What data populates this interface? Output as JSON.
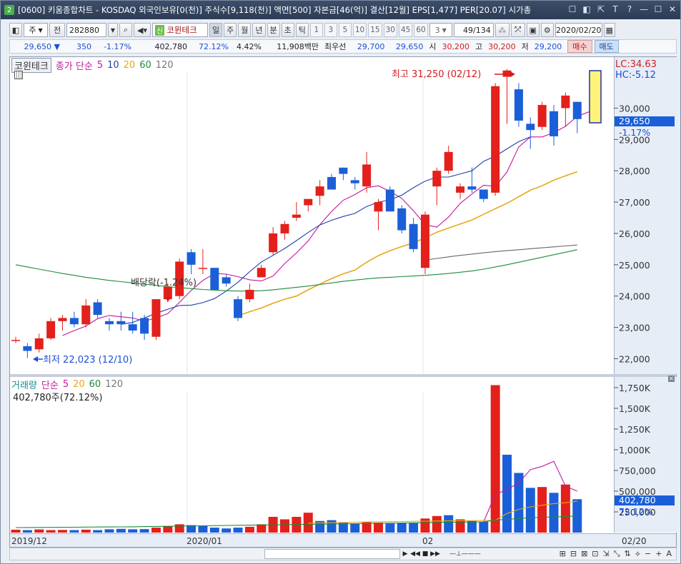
{
  "window": {
    "number": "2",
    "title": "[0600] 키움종합차트 - KOSDAQ 외국인보유[0(천)] 주식수[9,118(천)] 액면[500] 자본금[46(억)] 결산[12월] EPS[1,477] PER[20.07] 시가총",
    "controls": [
      "☐",
      "◧",
      "⇱",
      "T",
      "?",
      "—",
      "☐",
      "✕"
    ]
  },
  "toolbar": {
    "type_label": "주",
    "prev_label": "전",
    "code": "282880",
    "stock_name": "코윈테크",
    "shin_badge": "신",
    "period_buttons": [
      "일",
      "주",
      "월",
      "년",
      "분",
      "초",
      "틱"
    ],
    "minute_buttons": [
      "1",
      "3",
      "5",
      "10",
      "15",
      "30",
      "45",
      "60"
    ],
    "minute_custom": "3",
    "page_count": "49/134",
    "date": "2020/02/20"
  },
  "quote": {
    "price": "29,650 ▼",
    "change": "350",
    "change_pct": "-1.17%",
    "volume": "402,780",
    "volume_ratio": "72.12%",
    "turnover": "4.42%",
    "amount": "11,908백만",
    "best_label": "최우선",
    "ask": "29,700",
    "bid": "29,650",
    "open_label": "시",
    "open": "30,200",
    "high_label": "고",
    "high": "30,200",
    "low_label": "저",
    "low": "29,200",
    "buy_label": "매수",
    "sell_label": "매도"
  },
  "price_panel": {
    "stock_tag": "코윈테크",
    "legend_prefix": "종가 단순",
    "ma_periods": [
      "5",
      "10",
      "20",
      "60",
      "120"
    ],
    "ma_colors": [
      "#c2189b",
      "#1f3fa8",
      "#e6a817",
      "#1d8a3a",
      "#666666"
    ],
    "lc_label": "LC:34.63",
    "hc_label": "HC:-5.12",
    "current_price_label": "29,650",
    "current_change_label": "-1.17%",
    "high_annotation": "최고 31,250 (02/12)",
    "low_annotation": "최저 22,023 (12/10)",
    "dividend_annotation": "배당락(-1.24%)",
    "y_tick_labels": [
      "30,000",
      "29,000",
      "28,000",
      "27,000",
      "26,000",
      "25,000",
      "24,000",
      "23,000",
      "22,000"
    ]
  },
  "volume_panel": {
    "title": "거래량",
    "legend_prefix": "단순",
    "ma_periods": [
      "5",
      "20",
      "60",
      "120"
    ],
    "info": "402,780주(72.12%)",
    "current_label": "402,780",
    "current_pct_label": "72.12%",
    "y_tick_labels": [
      "1,750K",
      "1,500K",
      "1,250K",
      "1,000K",
      "750,000",
      "500,000",
      "250,000"
    ]
  },
  "date_axis": {
    "labels": [
      "2019/12",
      "2020/01",
      "02",
      "02/20"
    ]
  },
  "colors": {
    "up": "#e3201b",
    "down": "#1b5fd8",
    "ma5": "#c2189b",
    "ma10": "#1f3fa8",
    "ma20": "#e6a817",
    "ma60": "#1d8a3a",
    "ma120": "#666666"
  },
  "chart_data": [
    {
      "type": "candlestick",
      "title": "코윈테크",
      "ylim": [
        21600,
        31400
      ],
      "y_ticks": [
        22000,
        23000,
        24000,
        25000,
        26000,
        27000,
        28000,
        29000,
        30000
      ],
      "candles": [
        {
          "o": 22600,
          "h": 22700,
          "l": 22500,
          "c": 22600
        },
        {
          "o": 22400,
          "h": 22500,
          "l": 22020,
          "c": 22250
        },
        {
          "o": 22300,
          "h": 22800,
          "l": 22200,
          "c": 22650
        },
        {
          "o": 22650,
          "h": 23300,
          "l": 22600,
          "c": 23200
        },
        {
          "o": 23200,
          "h": 23400,
          "l": 22900,
          "c": 23300
        },
        {
          "o": 23300,
          "h": 23500,
          "l": 23000,
          "c": 23100
        },
        {
          "o": 23100,
          "h": 23900,
          "l": 23000,
          "c": 23700
        },
        {
          "o": 23800,
          "h": 23900,
          "l": 23300,
          "c": 23400
        },
        {
          "o": 23200,
          "h": 23300,
          "l": 22900,
          "c": 23100
        },
        {
          "o": 23200,
          "h": 23500,
          "l": 22900,
          "c": 23100
        },
        {
          "o": 23100,
          "h": 23500,
          "l": 22800,
          "c": 22900
        },
        {
          "o": 23300,
          "h": 23400,
          "l": 22600,
          "c": 22800
        },
        {
          "o": 22700,
          "h": 23900,
          "l": 22600,
          "c": 23900
        },
        {
          "o": 23900,
          "h": 24400,
          "l": 23800,
          "c": 24300
        },
        {
          "o": 24000,
          "h": 25200,
          "l": 23900,
          "c": 25100
        },
        {
          "o": 25400,
          "h": 25500,
          "l": 24700,
          "c": 25000
        },
        {
          "o": 24900,
          "h": 25500,
          "l": 24700,
          "c": 24900
        },
        {
          "o": 24900,
          "h": 24900,
          "l": 24200,
          "c": 24200
        },
        {
          "o": 24600,
          "h": 24700,
          "l": 24300,
          "c": 24400
        },
        {
          "o": 23900,
          "h": 24000,
          "l": 23200,
          "c": 23300
        },
        {
          "o": 23900,
          "h": 24400,
          "l": 23800,
          "c": 24200
        },
        {
          "o": 24600,
          "h": 25000,
          "l": 24600,
          "c": 24900
        },
        {
          "o": 25400,
          "h": 26200,
          "l": 25300,
          "c": 26000
        },
        {
          "o": 26000,
          "h": 26400,
          "l": 25800,
          "c": 26300
        },
        {
          "o": 26500,
          "h": 27000,
          "l": 26400,
          "c": 26600
        },
        {
          "o": 26900,
          "h": 27100,
          "l": 26700,
          "c": 27100
        },
        {
          "o": 27200,
          "h": 27700,
          "l": 26900,
          "c": 27500
        },
        {
          "o": 27800,
          "h": 27900,
          "l": 27400,
          "c": 27400
        },
        {
          "o": 28100,
          "h": 28100,
          "l": 27700,
          "c": 27900
        },
        {
          "o": 27700,
          "h": 27800,
          "l": 27400,
          "c": 27600
        },
        {
          "o": 27500,
          "h": 28600,
          "l": 27300,
          "c": 28200
        },
        {
          "o": 26700,
          "h": 27100,
          "l": 26100,
          "c": 27000
        },
        {
          "o": 27400,
          "h": 27500,
          "l": 26700,
          "c": 26700
        },
        {
          "o": 26800,
          "h": 26900,
          "l": 26000,
          "c": 26100
        },
        {
          "o": 26300,
          "h": 26500,
          "l": 25400,
          "c": 25500
        },
        {
          "o": 24900,
          "h": 26700,
          "l": 24700,
          "c": 26600
        },
        {
          "o": 27500,
          "h": 28100,
          "l": 26900,
          "c": 28000
        },
        {
          "o": 28000,
          "h": 28800,
          "l": 27900,
          "c": 28600
        },
        {
          "o": 27300,
          "h": 27600,
          "l": 27100,
          "c": 27500
        },
        {
          "o": 27500,
          "h": 28100,
          "l": 27300,
          "c": 27400
        },
        {
          "o": 27400,
          "h": 27400,
          "l": 27000,
          "c": 27100
        },
        {
          "o": 27300,
          "h": 30800,
          "l": 27200,
          "c": 30700
        },
        {
          "o": 31000,
          "h": 31250,
          "l": 29500,
          "c": 31200
        },
        {
          "o": 30600,
          "h": 30800,
          "l": 29400,
          "c": 29600
        },
        {
          "o": 29500,
          "h": 29700,
          "l": 28700,
          "c": 29300
        },
        {
          "o": 29400,
          "h": 30200,
          "l": 29300,
          "c": 30100
        },
        {
          "o": 29900,
          "h": 30100,
          "l": 28800,
          "c": 29100
        },
        {
          "o": 30000,
          "h": 30500,
          "l": 29400,
          "c": 30400
        },
        {
          "o": 30200,
          "h": 30200,
          "l": 29200,
          "c": 29650
        }
      ],
      "ma_series": [
        {
          "name": "5",
          "start_index": 4,
          "values": [
            22740,
            22900,
            23040,
            23280,
            23380,
            23340,
            23300,
            23200,
            23300,
            23440,
            23800,
            24180,
            24500,
            24720,
            24700,
            24620,
            24520,
            24480,
            24640,
            25040,
            25380,
            25760,
            26280,
            26700,
            27060,
            27240,
            27460,
            27520,
            27340,
            27120,
            26720,
            26280,
            26200,
            26520,
            26960,
            27260,
            27540,
            27500,
            27960,
            28760,
            29080,
            29080,
            29220,
            29420,
            29740,
            29880,
            29760
          ]
        },
        {
          "name": "10",
          "start_index": 9,
          "values": [
            23100,
            23160,
            23300,
            23450,
            23580,
            23700,
            23710,
            23790,
            23920,
            24160,
            24440,
            24780,
            25090,
            25300,
            25520,
            25770,
            26030,
            26270,
            26420,
            26540,
            26640,
            26860,
            27000,
            27070,
            27220,
            27460,
            27670,
            27800,
            27800,
            27900,
            28000,
            28300,
            28470,
            28700,
            28930,
            29080
          ]
        },
        {
          "name": "20",
          "start_index": 19,
          "values": [
            23370,
            23500,
            23620,
            23770,
            23900,
            24000,
            24200,
            24380,
            24560,
            24710,
            24830,
            25080,
            25290,
            25450,
            25580,
            25700,
            25860,
            26040,
            26170,
            26300,
            26430,
            26610,
            26790,
            26960,
            27170,
            27380,
            27520,
            27700,
            27840,
            27970
          ]
        },
        {
          "name": "60",
          "start_index": 0,
          "values": [
            25000,
            24930,
            24860,
            24790,
            24720,
            24660,
            24600,
            24550,
            24500,
            24460,
            24420,
            24380,
            24340,
            24300,
            24270,
            24240,
            24210,
            24190,
            24170,
            24160,
            24160,
            24170,
            24200,
            24240,
            24280,
            24320,
            24370,
            24420,
            24470,
            24510,
            24550,
            24580,
            24600,
            24620,
            24640,
            24660,
            24690,
            24720,
            24760,
            24800,
            24860,
            24930,
            25000,
            25080,
            25160,
            25240,
            25320,
            25400,
            25480
          ]
        },
        {
          "name": "120",
          "start_index": 35,
          "values": [
            25150,
            25200,
            25250,
            25300,
            25340,
            25380,
            25420,
            25450,
            25480,
            25510,
            25540,
            25570,
            25600,
            25630
          ]
        }
      ]
    },
    {
      "type": "bar",
      "title": "거래량",
      "ylim": [
        0,
        1870000
      ],
      "y_ticks": [
        250000,
        500000,
        750000,
        1000000,
        1250000,
        1500000,
        1750000
      ],
      "values": [
        35000,
        30000,
        38000,
        30000,
        32000,
        30000,
        35000,
        30000,
        40000,
        45000,
        40000,
        42000,
        60000,
        80000,
        100000,
        90000,
        80000,
        60000,
        50000,
        60000,
        70000,
        100000,
        190000,
        160000,
        190000,
        240000,
        140000,
        150000,
        120000,
        110000,
        130000,
        120000,
        110000,
        120000,
        115000,
        170000,
        200000,
        210000,
        160000,
        140000,
        130000,
        1780000,
        940000,
        720000,
        540000,
        550000,
        480000,
        580000,
        402780
      ],
      "up": [
        1,
        0,
        1,
        1,
        1,
        0,
        1,
        0,
        0,
        0,
        0,
        0,
        1,
        1,
        1,
        0,
        0,
        0,
        0,
        0,
        1,
        1,
        1,
        1,
        1,
        1,
        0,
        0,
        0,
        0,
        1,
        1,
        0,
        0,
        0,
        1,
        1,
        0,
        1,
        0,
        0,
        1,
        0,
        0,
        0,
        1,
        0,
        1,
        0
      ],
      "ma_series": [
        {
          "name": "5",
          "start_index": 40,
          "values": [
            130000,
            460000,
            520000,
            600000,
            760000,
            800000,
            860000,
            560000,
            500000
          ]
        },
        {
          "name": "20",
          "start_index": 25,
          "values": [
            115000,
            117000,
            120000,
            122000,
            125000,
            128000,
            130000,
            132000,
            134000,
            136000,
            138000,
            140000,
            142000,
            144000,
            145000,
            147000,
            148000,
            230000,
            280000,
            310000,
            330000,
            350000,
            360000,
            380000
          ]
        },
        {
          "name": "60",
          "start_index": 0,
          "values": [
            60000,
            61000,
            62000,
            63000,
            64000,
            65000,
            66000,
            67000,
            68000,
            69000,
            70000,
            72000,
            74000,
            76000,
            78000,
            80000,
            82000,
            84000,
            86000,
            88000,
            90000,
            92000,
            94000,
            96000,
            98000,
            100000,
            102000,
            104000,
            106000,
            108000,
            110000,
            112000,
            114000,
            116000,
            118000,
            120000,
            122000,
            124000,
            126000,
            128000,
            130000,
            150000,
            160000,
            170000,
            180000,
            185000,
            190000,
            195000,
            200000
          ]
        }
      ]
    }
  ]
}
